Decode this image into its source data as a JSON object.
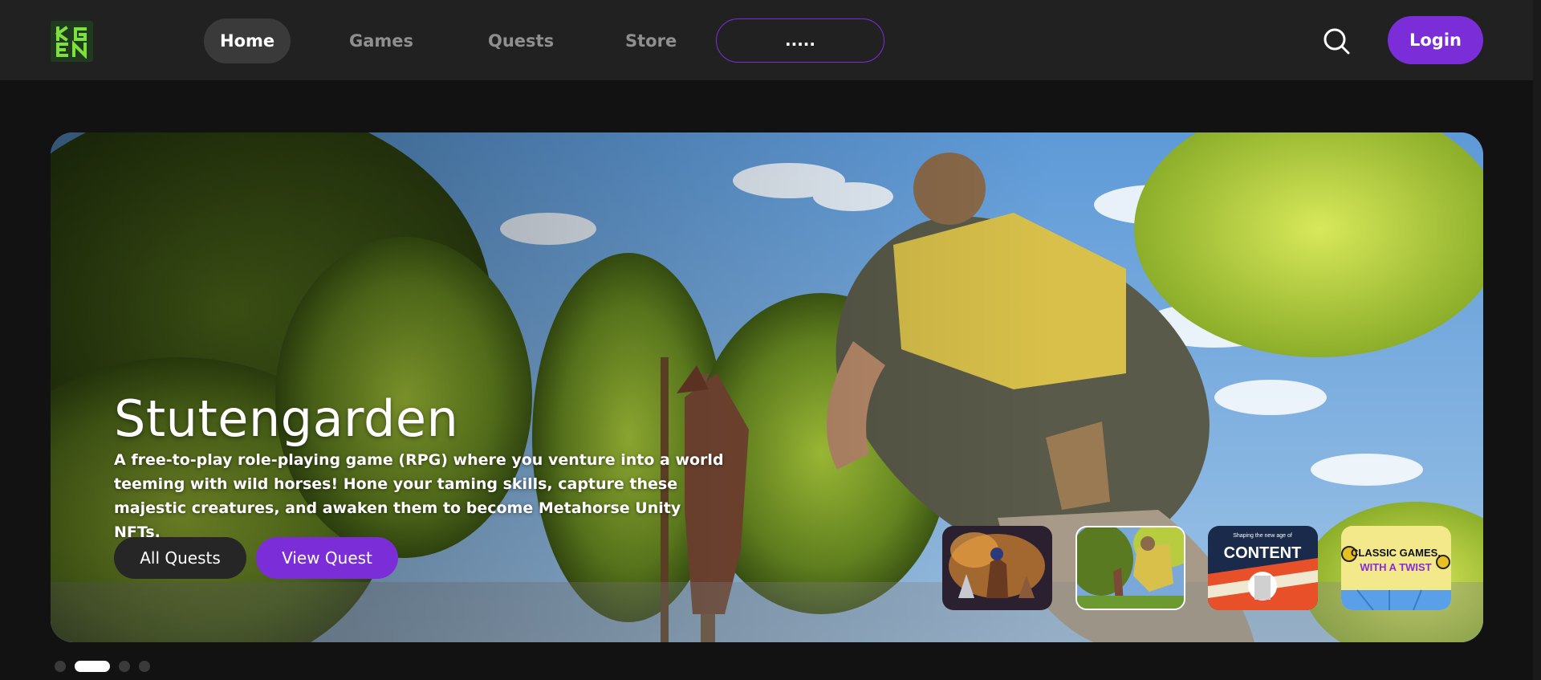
{
  "header": {
    "logo_text": "KGEN",
    "nav": [
      {
        "label": "Home",
        "active": true
      },
      {
        "label": "Games",
        "active": false
      },
      {
        "label": "Quests",
        "active": false
      },
      {
        "label": "Store",
        "active": false
      }
    ],
    "pill_label": ".....",
    "search_icon": "search-icon",
    "login_label": "Login"
  },
  "hero": {
    "title": "Stutengarden",
    "description": "A free-to-play role-playing game (RPG) where you venture into a world teeming with wild horses! Hone your taming skills, capture these majestic creatures, and awaken them to become Metahorse Unity NFTs.",
    "all_quests_label": "All Quests",
    "view_quest_label": "View Quest",
    "thumbnails": [
      {
        "caption": "",
        "selected": false
      },
      {
        "caption": "",
        "selected": true
      },
      {
        "caption_top": "Shaping the new age of",
        "caption": "CONTENT",
        "selected": false
      },
      {
        "caption": "CLASSIC GAMES,",
        "caption2": "WITH A TWIST",
        "selected": false
      }
    ]
  },
  "carousel": {
    "total": 4,
    "active_index": 1
  },
  "colors": {
    "accent": "#7b2ed8",
    "logo_green": "#7ee03a",
    "topbar": "#212121",
    "background": "#121212"
  }
}
